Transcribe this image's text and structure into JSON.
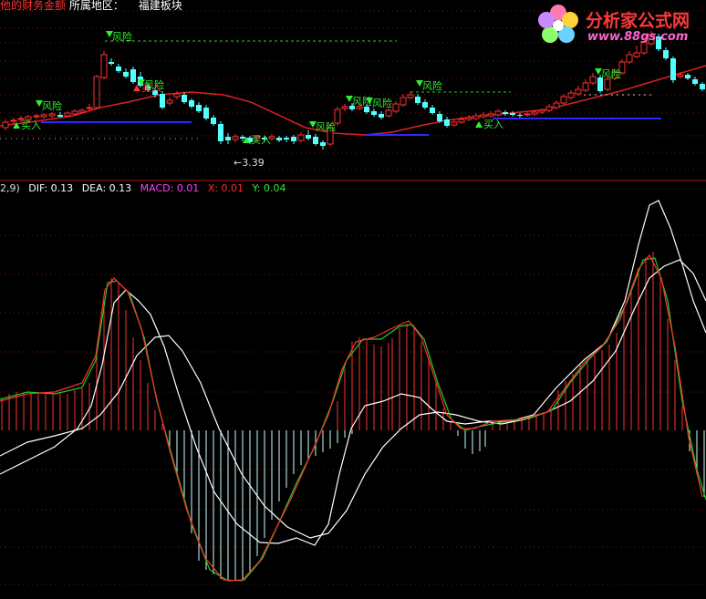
{
  "header": {
    "left_fragment": "他的财务金额",
    "region_label": "所属地区：",
    "sector_label": "福建板块"
  },
  "indicator_line": {
    "params_fragment": "2,9)",
    "dif": "DIF: 0.13",
    "dea": "DEA: 0.13",
    "macd": "MACD: 0.01",
    "x": "X: 0.01",
    "y": "Y: 0.04"
  },
  "logo": {
    "name": "分析家公式网",
    "url": "www.88gs.com",
    "icon": "flower-logo-icon"
  },
  "colors": {
    "background": "#000000",
    "grid": "#8b1010",
    "up_candle": "#ff3030",
    "down_candle": "#54ffff",
    "ma_line": "#e02020",
    "support_line": "#2a2aff",
    "green_line": "#20d020",
    "white_line": "#ffffff",
    "signal_green": "#33ee33",
    "signal_red": "#ff3030"
  },
  "chart_data": [
    {
      "type": "candlestick",
      "panel": "price",
      "annotations": [
        {
          "label": "风险",
          "kind": "risk"
        },
        {
          "label": "风险",
          "kind": "risk"
        },
        {
          "label": "风险",
          "kind": "risk"
        },
        {
          "label": "风险",
          "kind": "risk"
        },
        {
          "label": "风险",
          "kind": "risk"
        },
        {
          "label": "风险",
          "kind": "risk"
        },
        {
          "label": "风险",
          "kind": "risk"
        },
        {
          "label": "风险",
          "kind": "risk"
        },
        {
          "label": "买入",
          "kind": "buy"
        },
        {
          "label": "买入",
          "kind": "buy"
        },
        {
          "label": "买入",
          "kind": "buy"
        },
        {
          "label": "买入",
          "kind": "buy"
        }
      ],
      "low_marker": "3.39"
    },
    {
      "type": "macd",
      "panel": "indicator",
      "values": {
        "DIF": 0.13,
        "DEA": 0.13,
        "MACD": 0.01,
        "X": 0.01,
        "Y": 0.04
      }
    }
  ]
}
